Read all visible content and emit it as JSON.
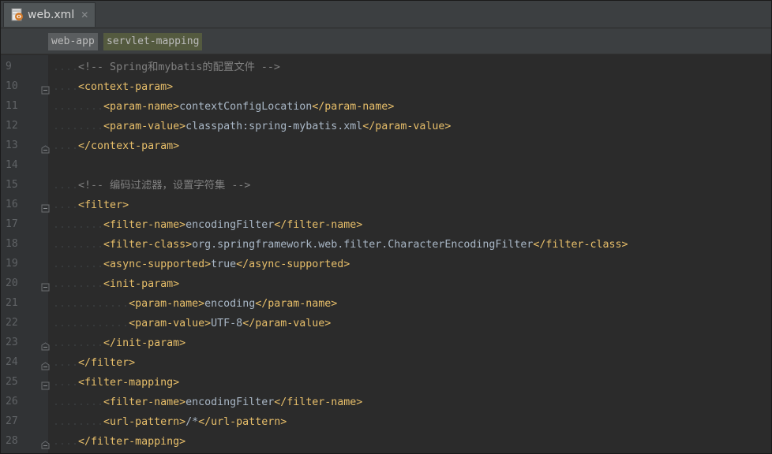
{
  "tab": {
    "filename": "web.xml",
    "close_glyph": "✕",
    "icon": "xml-file-icon"
  },
  "breadcrumbs": [
    "web-app",
    "servlet-mapping"
  ],
  "lines": [
    {
      "n": "9",
      "indent": 1,
      "fold": "",
      "parts": [
        {
          "c": "cmt",
          "t": "<!-- Spring和mybatis的配置文件 -->"
        }
      ]
    },
    {
      "n": "10",
      "indent": 1,
      "fold": "open",
      "parts": [
        {
          "c": "tag",
          "t": "<context-param>"
        }
      ]
    },
    {
      "n": "11",
      "indent": 2,
      "fold": "",
      "parts": [
        {
          "c": "tag",
          "t": "<param-name>"
        },
        {
          "c": "txt",
          "t": "contextConfigLocation"
        },
        {
          "c": "tag",
          "t": "</param-name>"
        }
      ]
    },
    {
      "n": "12",
      "indent": 2,
      "fold": "",
      "parts": [
        {
          "c": "tag",
          "t": "<param-value>"
        },
        {
          "c": "txt",
          "t": "classpath:spring-mybatis.xml"
        },
        {
          "c": "tag",
          "t": "</param-value>"
        }
      ]
    },
    {
      "n": "13",
      "indent": 1,
      "fold": "close",
      "parts": [
        {
          "c": "tag",
          "t": "</context-param>"
        }
      ]
    },
    {
      "n": "14",
      "indent": 0,
      "fold": "",
      "parts": []
    },
    {
      "n": "15",
      "indent": 1,
      "fold": "",
      "parts": [
        {
          "c": "cmt",
          "t": "<!-- 编码过滤器，设置字符集 -->"
        }
      ]
    },
    {
      "n": "16",
      "indent": 1,
      "fold": "open",
      "parts": [
        {
          "c": "tag",
          "t": "<filter>"
        }
      ]
    },
    {
      "n": "17",
      "indent": 2,
      "fold": "",
      "parts": [
        {
          "c": "tag",
          "t": "<filter-name>"
        },
        {
          "c": "txt",
          "t": "encodingFilter"
        },
        {
          "c": "tag",
          "t": "</filter-name>"
        }
      ]
    },
    {
      "n": "18",
      "indent": 2,
      "fold": "",
      "parts": [
        {
          "c": "tag",
          "t": "<filter-class>"
        },
        {
          "c": "txt",
          "t": "org.springframework.web.filter.CharacterEncodingFilter"
        },
        {
          "c": "tag",
          "t": "</filter-class>"
        }
      ]
    },
    {
      "n": "19",
      "indent": 2,
      "fold": "",
      "parts": [
        {
          "c": "tag",
          "t": "<async-supported>"
        },
        {
          "c": "txt",
          "t": "true"
        },
        {
          "c": "tag",
          "t": "</async-supported>"
        }
      ]
    },
    {
      "n": "20",
      "indent": 2,
      "fold": "open",
      "parts": [
        {
          "c": "tag",
          "t": "<init-param>"
        }
      ]
    },
    {
      "n": "21",
      "indent": 3,
      "fold": "",
      "parts": [
        {
          "c": "tag",
          "t": "<param-name>"
        },
        {
          "c": "txt",
          "t": "encoding"
        },
        {
          "c": "tag",
          "t": "</param-name>"
        }
      ]
    },
    {
      "n": "22",
      "indent": 3,
      "fold": "",
      "parts": [
        {
          "c": "tag",
          "t": "<param-value>"
        },
        {
          "c": "txt",
          "t": "UTF-8"
        },
        {
          "c": "tag",
          "t": "</param-value>"
        }
      ]
    },
    {
      "n": "23",
      "indent": 2,
      "fold": "close",
      "parts": [
        {
          "c": "tag",
          "t": "</init-param>"
        }
      ]
    },
    {
      "n": "24",
      "indent": 1,
      "fold": "close",
      "parts": [
        {
          "c": "tag",
          "t": "</filter>"
        }
      ]
    },
    {
      "n": "25",
      "indent": 1,
      "fold": "open",
      "parts": [
        {
          "c": "tag",
          "t": "<filter-mapping>"
        }
      ]
    },
    {
      "n": "26",
      "indent": 2,
      "fold": "",
      "parts": [
        {
          "c": "tag",
          "t": "<filter-name>"
        },
        {
          "c": "txt",
          "t": "encodingFilter"
        },
        {
          "c": "tag",
          "t": "</filter-name>"
        }
      ]
    },
    {
      "n": "27",
      "indent": 2,
      "fold": "",
      "parts": [
        {
          "c": "tag",
          "t": "<url-pattern>"
        },
        {
          "c": "txt",
          "t": "/*"
        },
        {
          "c": "tag",
          "t": "</url-pattern>"
        }
      ]
    },
    {
      "n": "28",
      "indent": 1,
      "fold": "close",
      "parts": [
        {
          "c": "tag",
          "t": "</filter-mapping>"
        }
      ]
    }
  ],
  "colors": {
    "tag": "#e8bf6a",
    "text": "#a9b7c6",
    "comment": "#808080",
    "background": "#2b2b2b",
    "gutter": "#313335"
  }
}
